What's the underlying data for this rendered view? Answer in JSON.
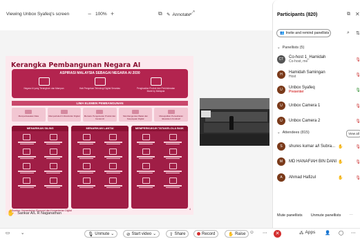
{
  "share_bar": {
    "viewing": "Viewing Unbox Syafeq's screen",
    "zoom_minus": "−",
    "zoom": "100%",
    "zoom_plus": "+",
    "annotate": "Annotate"
  },
  "slide": {
    "title": "Kerangka Pembangunan Negara AI",
    "aspirasi_heading": "ASPIRASI MALAYSIA SEBAGAI NEGARA AI 2030",
    "aspirasi_cols": [
      "Negara AI yang Terangkum dan Mampan",
      "Hab Pengeluar Teknologi Digital Serantau",
      "Penghasilan Produk dan Perkhidmatan Made by Malaysia"
    ],
    "lima_heading": "LIMA ELEMEN PEMBANGUNAN",
    "lima": [
      "Memperkasakan Data",
      "Memperkukuh Infrastruktur Digital",
      "Memacu Pengeluaran Produk dan Inovasi AI",
      "Membangunkan Bakat dan Keupayaan Digital",
      "Mewujudkan Persekitaran Ekosistem Kondusif"
    ],
    "pillars": [
      "MENARIKAN SILING",
      "MENARIKAN LANTAI",
      "MEMPERKUKUH TATAKELOLA BAIK"
    ],
    "source": "Sumber: Kementerian Ekonomi dan Kementerian Digital",
    "page": "4"
  },
  "speaker": {
    "name": "Sankar A/L R Naganathan"
  },
  "toolbar": {
    "unmute": "Unmute",
    "start_video": "Start video",
    "share": "Share",
    "record": "Record",
    "raise": "Raise",
    "apps": "Apps"
  },
  "panel": {
    "title": "Participants (820)",
    "invite": "Invite and remind panellists",
    "panellists_header": "Panellists (5)",
    "panellists": [
      {
        "initials": "CT",
        "name": "Co-host 1_Hamidah",
        "sub": "Co-host, me",
        "sub_red": false,
        "mic": "muted"
      },
      {
        "initials": "H",
        "name": "Hamidah Samingan",
        "sub": "Host",
        "sub_red": false,
        "mic": "muted"
      },
      {
        "initials": "U",
        "name": "Unbox Syafeq",
        "sub": "Presenter",
        "sub_red": true,
        "mic": "on"
      },
      {
        "initials": "U",
        "name": "Unbox Camera 1",
        "sub": "",
        "sub_red": false,
        "mic": "muted"
      },
      {
        "initials": "U",
        "name": "Unbox Camera 2",
        "sub": "",
        "sub_red": false,
        "mic": "muted"
      }
    ],
    "attendees_header": "Attendees (815)",
    "view_all": "View all",
    "attendees": [
      {
        "initials": "S",
        "name": "shures kumar a/l Subra..."
      },
      {
        "initials": "M",
        "name": "MD HANAFIAH BIN DANI"
      },
      {
        "initials": "A",
        "name": "Ahmad Hafizul"
      }
    ],
    "mute_panellists": "Mute panellists",
    "unmute_panellists": "Unmute panellists"
  }
}
